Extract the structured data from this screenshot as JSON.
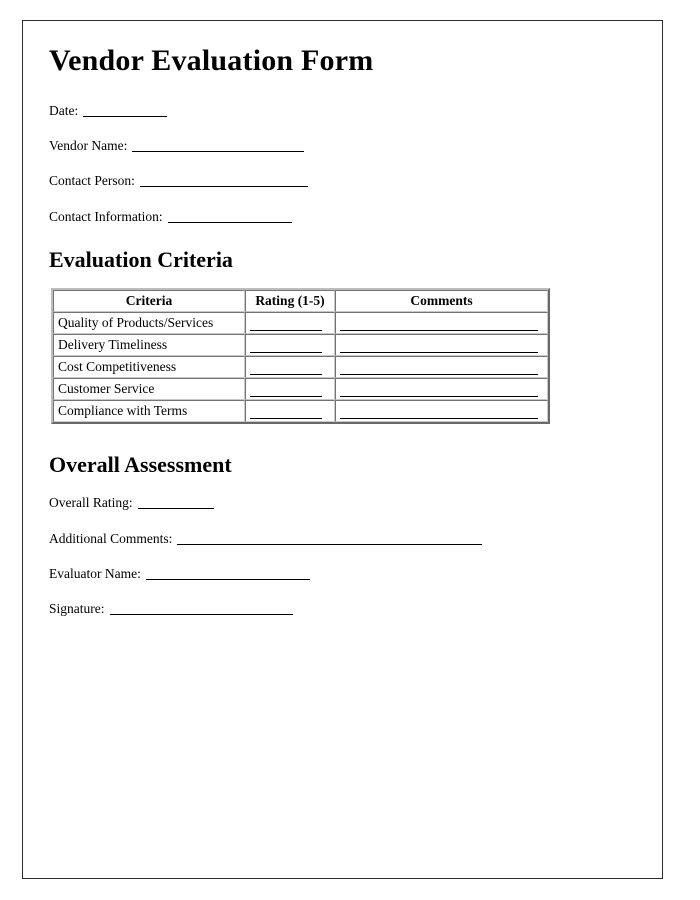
{
  "document": {
    "title": "Vendor Evaluation Form"
  },
  "header_fields": [
    {
      "label": "Date:",
      "blank_class": "w-date",
      "name": "date-field"
    },
    {
      "label": "Vendor Name:",
      "blank_class": "w-vendor",
      "name": "vendor-name-field"
    },
    {
      "label": "Contact Person:",
      "blank_class": "w-contactp",
      "name": "contact-person-field"
    },
    {
      "label": "Contact Information:",
      "blank_class": "w-contacti",
      "name": "contact-information-field"
    }
  ],
  "criteria_section": {
    "heading": "Evaluation Criteria",
    "table": {
      "columns": [
        "Criteria",
        "Rating (1-5)",
        "Comments"
      ],
      "rows": [
        {
          "criteria": "Quality of Products/Services",
          "rating": "",
          "comments": ""
        },
        {
          "criteria": "Delivery Timeliness",
          "rating": "",
          "comments": ""
        },
        {
          "criteria": "Cost Competitiveness",
          "rating": "",
          "comments": ""
        },
        {
          "criteria": "Customer Service",
          "rating": "",
          "comments": ""
        },
        {
          "criteria": "Compliance with Terms",
          "rating": "",
          "comments": ""
        }
      ]
    }
  },
  "assessment_section": {
    "heading": "Overall Assessment",
    "fields": [
      {
        "label": "Overall Rating:",
        "blank_class": "w-rating",
        "name": "overall-rating-field"
      },
      {
        "label": "Additional Comments:",
        "blank_class": "w-addcom",
        "name": "additional-comments-field"
      },
      {
        "label": "Evaluator Name:",
        "blank_class": "w-evalname",
        "name": "evaluator-name-field"
      },
      {
        "label": "Signature:",
        "blank_class": "w-signature",
        "name": "signature-field"
      }
    ]
  }
}
